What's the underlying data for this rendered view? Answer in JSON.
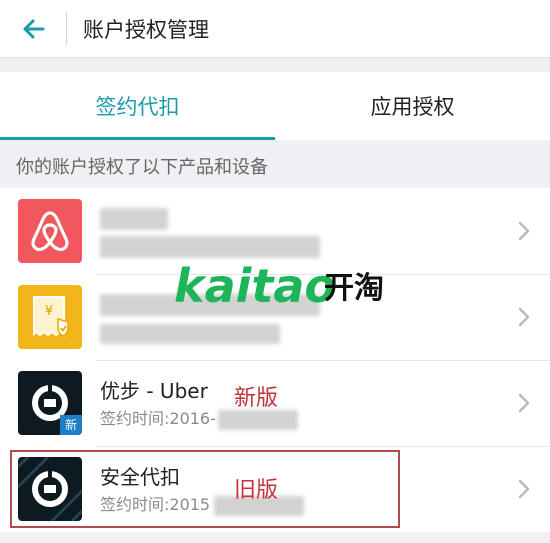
{
  "header": {
    "title": "账户授权管理"
  },
  "tabs": [
    {
      "label": "签约代扣",
      "active": true
    },
    {
      "label": "应用授权",
      "active": false
    }
  ],
  "section": {
    "label": "你的账户授权了以下产品和设备"
  },
  "items": [
    {
      "name": "",
      "date": "",
      "icon": "airbnb-logo",
      "color": "#f0585e"
    },
    {
      "name": "",
      "date": "",
      "icon": "receipt-icon",
      "color": "#f2b51a"
    },
    {
      "name": "优步 - Uber",
      "date": "签约时间:2016-",
      "icon": "uber-logo",
      "color": "#0e1a22",
      "badge": "新",
      "tag": "新版"
    },
    {
      "name": "安全代扣",
      "date": "签约时间:2015",
      "icon": "uber-logo",
      "color": "#0e1a22",
      "tag": "旧版"
    }
  ],
  "watermark": {
    "text": "kaitao",
    "han": "开淘",
    "colors": [
      "#1eb45a",
      "#111111"
    ]
  },
  "colors": {
    "accent": "#1a9ba9",
    "tag": "#c2343c"
  }
}
